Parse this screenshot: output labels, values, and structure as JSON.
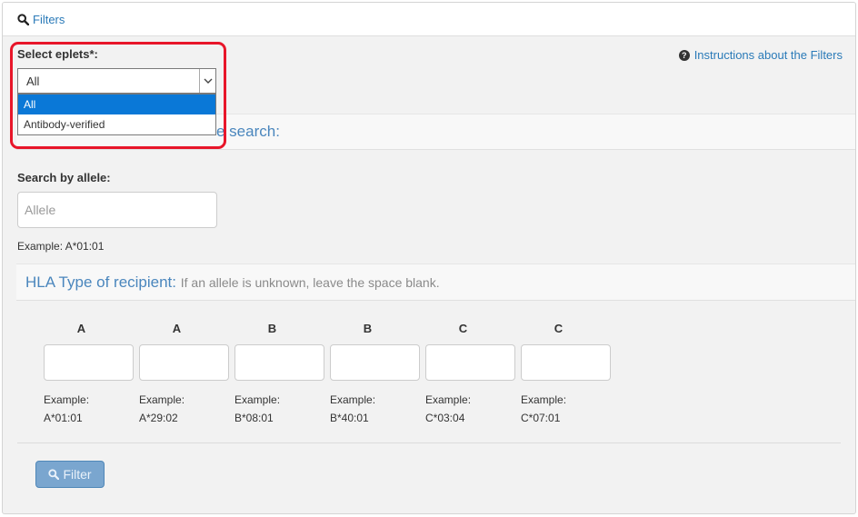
{
  "header": {
    "filters_label": "Filters"
  },
  "eplets": {
    "label": "Select eplets*:",
    "selected": "All",
    "options": [
      {
        "label": "All",
        "selected": true
      },
      {
        "label": "Antibody-verified",
        "selected": false
      }
    ]
  },
  "instructions_link": "Instructions about the Filters",
  "section_partial_title": "e search:",
  "allele_search": {
    "label": "Search by allele:",
    "placeholder": "Allele",
    "example": "Example: A*01:01"
  },
  "hla": {
    "title": "HLA Type of recipient:",
    "hint": "If an allele is unknown, leave the space blank.",
    "example_label": "Example:",
    "columns": [
      {
        "locus": "A",
        "example": "A*01:01"
      },
      {
        "locus": "A",
        "example": "A*29:02"
      },
      {
        "locus": "B",
        "example": "B*08:01"
      },
      {
        "locus": "B",
        "example": "B*40:01"
      },
      {
        "locus": "C",
        "example": "C*03:04"
      },
      {
        "locus": "C",
        "example": "C*07:01"
      }
    ]
  },
  "filter_button": "Filter",
  "colors": {
    "link": "#2a7ab8",
    "section_title": "#4a86bd",
    "dropdown_highlight": "#0a78d7",
    "annotation_red": "#e8162a",
    "button": "#7aa6cf"
  },
  "icons": {
    "filters": "search-icon",
    "instructions": "question-circle-icon",
    "select_arrow": "chevron-down-icon",
    "filter_button": "search-icon"
  }
}
